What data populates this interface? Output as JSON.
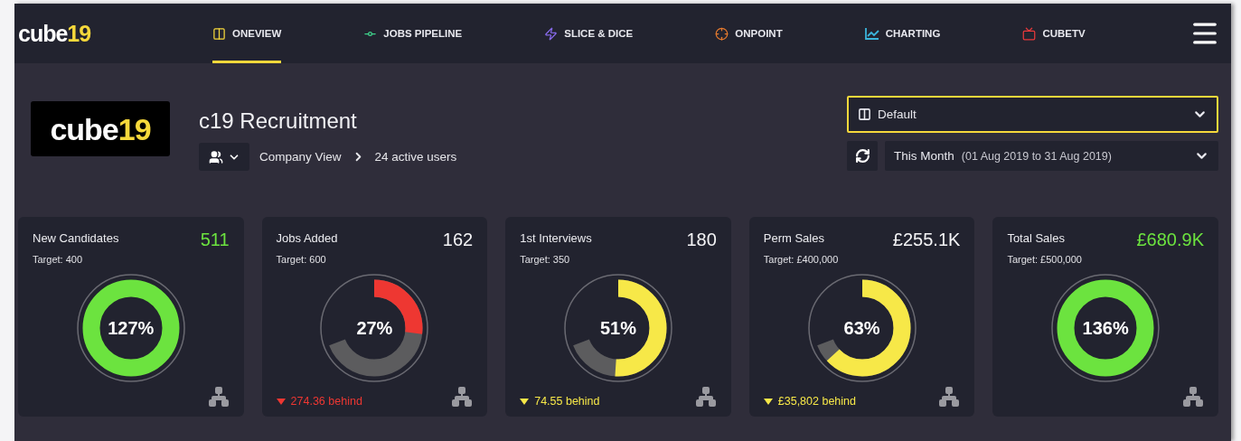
{
  "logo": {
    "text": "cube",
    "accent": "19"
  },
  "nav": [
    {
      "label": "ONEVIEW",
      "selected": true
    },
    {
      "label": "JOBS PIPELINE",
      "selected": false
    },
    {
      "label": "SLICE & DICE",
      "selected": false
    },
    {
      "label": "ONPOINT",
      "selected": false
    },
    {
      "label": "CHARTING",
      "selected": false
    },
    {
      "label": "CUBETV",
      "selected": false
    }
  ],
  "company": {
    "logo": {
      "text": "cube",
      "accent": "19"
    },
    "title": "c19 Recruitment",
    "breadcrumb": [
      "Company View",
      "24 active users"
    ]
  },
  "layout_select": {
    "value": "Default"
  },
  "period_select": {
    "value": "This Month",
    "range": "(01 Aug 2019 to 31 Aug 2019)"
  },
  "cards": [
    {
      "title": "New Candidates",
      "value": "511",
      "target": "Target: 400",
      "percent": "127%",
      "on_target": true,
      "color": "#6ce33f",
      "gauge": {
        "level": 1
      }
    },
    {
      "title": "Jobs Added",
      "value": "162",
      "target": "Target: 600",
      "percent": "27%",
      "on_target": false,
      "color": "#ee3732",
      "gauge": {
        "level": 0.27
      },
      "behind": "274.36 behind"
    },
    {
      "title": "1st Interviews",
      "value": "180",
      "target": "Target: 350",
      "percent": "51%",
      "on_target": false,
      "color": "#f7e848",
      "gauge": {
        "level": 0.51
      },
      "behind": "74.55 behind"
    },
    {
      "title": "Perm Sales",
      "value": "£255.1K",
      "target": "Target: £400,000",
      "percent": "63%",
      "on_target": false,
      "color": "#f7e848",
      "gauge": {
        "level": 0.63
      },
      "behind": "£35,802 behind"
    },
    {
      "title": "Total Sales",
      "value": "£680.9K",
      "target": "Target: £500,000",
      "percent": "136%",
      "on_target": true,
      "color": "#6ce33f",
      "gauge": {
        "level": 1
      }
    }
  ]
}
